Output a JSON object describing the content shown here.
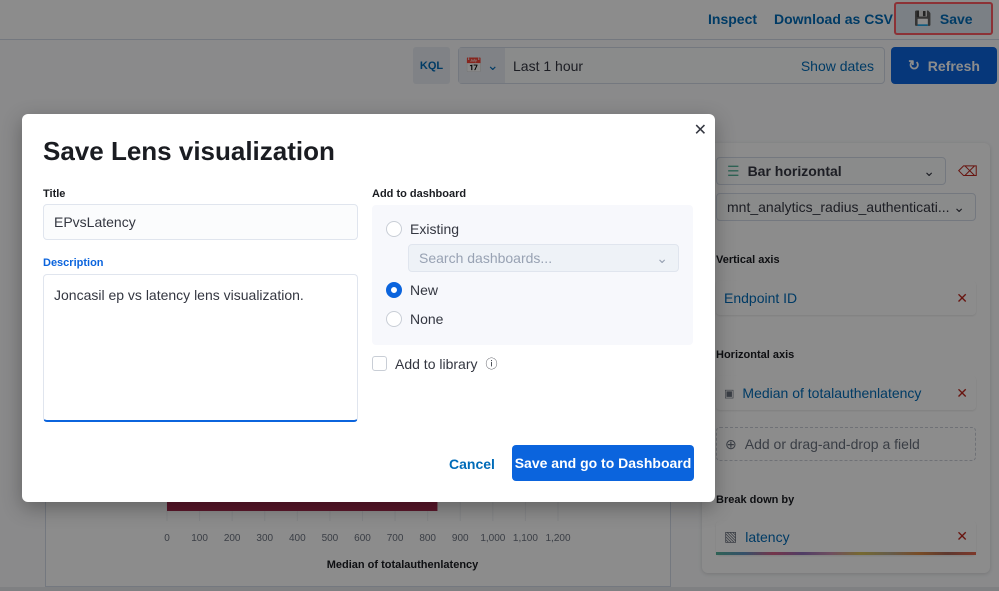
{
  "header": {
    "inspect": "Inspect",
    "download_csv": "Download as CSV",
    "save": "Save"
  },
  "query_bar": {
    "language": "KQL",
    "time_range": "Last 1 hour",
    "show_dates": "Show dates",
    "refresh": "Refresh"
  },
  "chart": {
    "x_ticks": [
      "0",
      "100",
      "200",
      "300",
      "400",
      "500",
      "600",
      "700",
      "800",
      "900",
      "1,000",
      "1,100",
      "1,200"
    ],
    "xlabel": "Median of totalauthenlatency",
    "bar_value": 830,
    "bar_color": "#a6294f",
    "xlim": [
      0,
      1200
    ]
  },
  "config_panel": {
    "chart_type": "Bar horizontal",
    "data_view": "mnt_analytics_radius_authenticati...",
    "vertical_axis": {
      "label": "Vertical axis",
      "field": "Endpoint ID"
    },
    "horizontal_axis": {
      "label": "Horizontal axis",
      "field": "Median of totalauthenlatency",
      "add": "Add or drag-and-drop a field"
    },
    "breakdown": {
      "label": "Break down by",
      "field": "latency"
    }
  },
  "modal": {
    "title": "Save Lens visualization",
    "title_label": "Title",
    "title_value": "EPvsLatency",
    "description_label": "Description",
    "description_value": "Joncasil ep vs latency lens visualization.",
    "dashboard_label": "Add to dashboard",
    "options": [
      {
        "label": "Existing",
        "selected": false
      },
      {
        "label": "New",
        "selected": true
      },
      {
        "label": "None",
        "selected": false
      }
    ],
    "search_placeholder": "Search dashboards...",
    "library_label": "Add to library",
    "library_checked": false,
    "cancel": "Cancel",
    "confirm": "Save and go to Dashboard"
  },
  "colors": {
    "accent": "#0b64dd",
    "link": "#006bb8",
    "danger": "#bd271e",
    "highlight": "#f5545c"
  }
}
